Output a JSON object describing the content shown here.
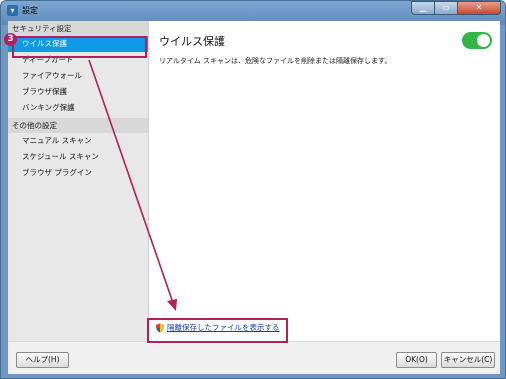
{
  "window": {
    "title": "設定",
    "min_label": "▁",
    "max_label": "▭",
    "close_label": "✕"
  },
  "sidebar": {
    "groups": [
      {
        "label": "セキュリティ設定",
        "items": [
          "ウイルス保護",
          "ディープガード",
          "ファイアウォール",
          "ブラウザ保護",
          "バンキング保護"
        ]
      },
      {
        "label": "その他の設定",
        "items": [
          "マニュアル スキャン",
          "スケジュール スキャン",
          "ブラウザ プラグイン"
        ]
      }
    ],
    "selected": "ウイルス保護"
  },
  "content": {
    "title": "ウイルス保護",
    "description": "リアルタイム スキャンは、危険なファイルを削除または隔離保存します。",
    "toggle_on": 1,
    "quarantine_link": "隔離保存したファイルを表示する"
  },
  "footer": {
    "help": "ヘルプ(H)",
    "ok": "OK(O)",
    "cancel": "キャンセル(C)"
  },
  "annotation": {
    "step": "3",
    "color": "#b0215a"
  },
  "colors": {
    "accent": "#0e9ae6",
    "toggle": "#35b545",
    "link": "#1a3db8"
  }
}
